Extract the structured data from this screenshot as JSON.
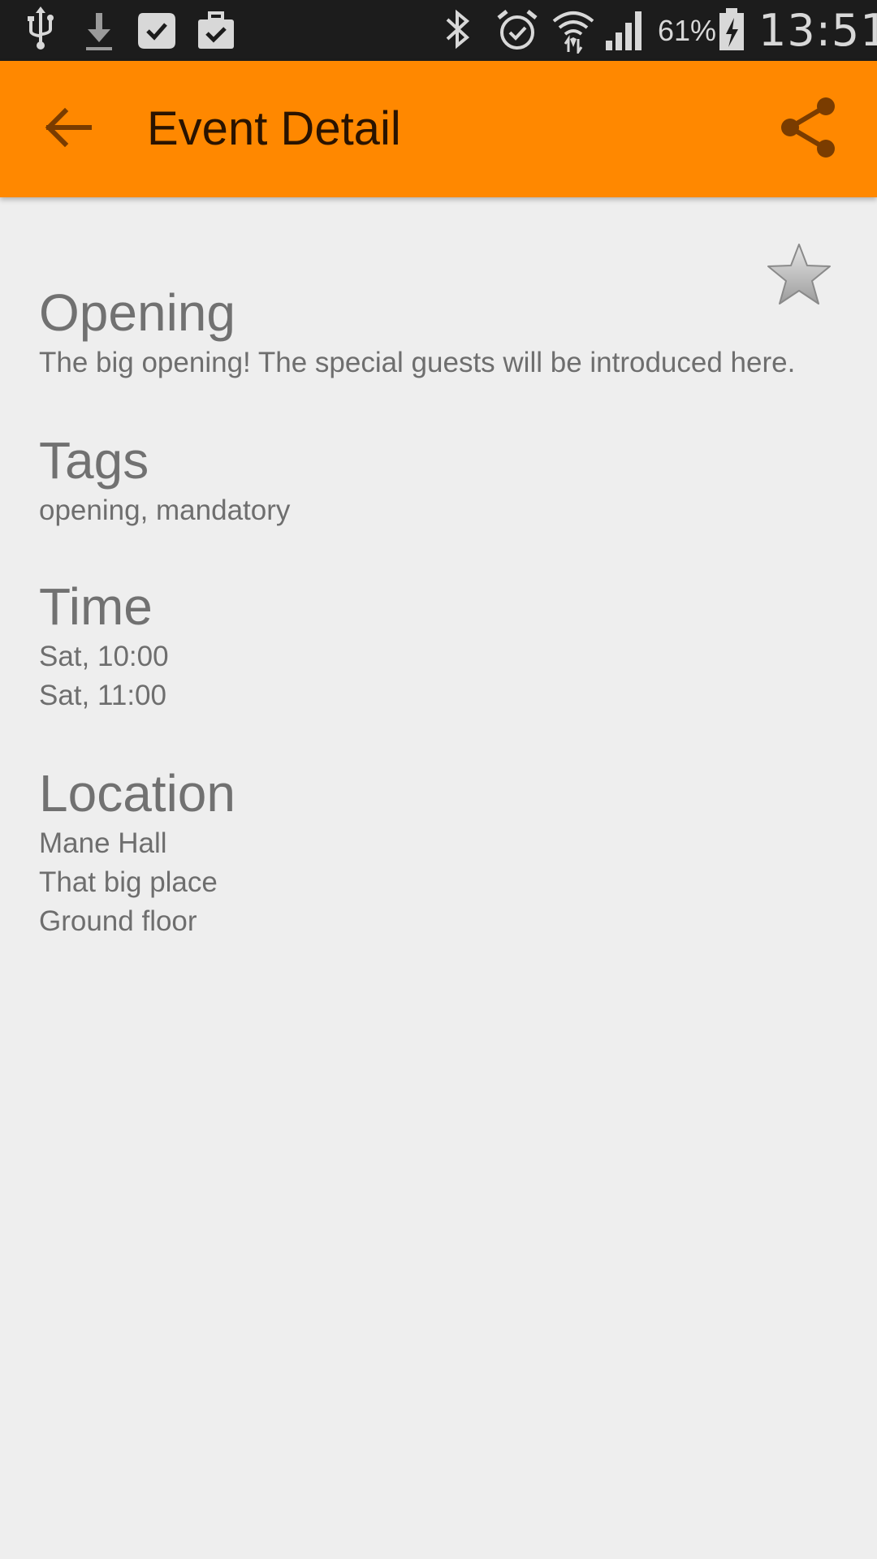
{
  "status_bar": {
    "left_icons": [
      "usb-icon",
      "download-icon",
      "check-bubble-icon",
      "briefcase-check-icon"
    ],
    "right_icons": [
      "bluetooth-icon",
      "alarm-icon",
      "wifi-icon",
      "cell-signal-icon",
      "battery-charging-icon"
    ],
    "battery_percent": "61%",
    "time": "13:51"
  },
  "app_bar": {
    "title": "Event Detail",
    "color": "#ff8800",
    "back_icon": "arrow-back-icon",
    "share_icon": "share-icon"
  },
  "event": {
    "favorite_icon": "star-icon",
    "title": "Opening",
    "description": "The big opening! The special guests will be introduced here.",
    "tags_heading": "Tags",
    "tags": "opening, mandatory",
    "time_heading": "Time",
    "time_lines": [
      "Sat, 10:00",
      "Sat, 11:00"
    ],
    "location_heading": "Location",
    "location_lines": [
      "Mane Hall",
      "That big place",
      "Ground floor"
    ]
  }
}
